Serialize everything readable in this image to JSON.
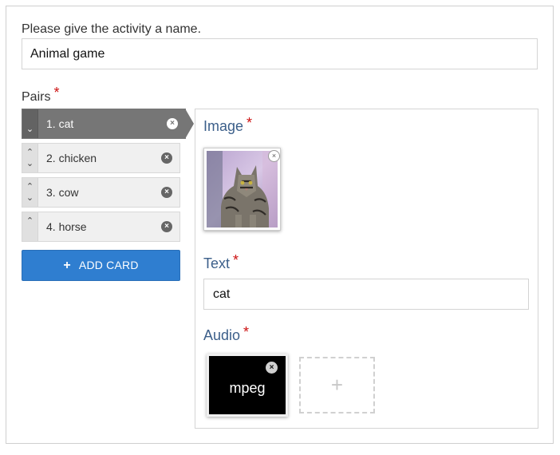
{
  "header": {
    "title_label": "Please give the activity a name.",
    "title_value": "Animal game"
  },
  "pairs": {
    "label": "Pairs",
    "required_mark": "*",
    "items": [
      {
        "label": "1. cat",
        "active": true
      },
      {
        "label": "2. chicken",
        "active": false
      },
      {
        "label": "3. cow",
        "active": false
      },
      {
        "label": "4. horse",
        "active": false
      }
    ],
    "remove_glyph": "×",
    "up_glyph": "⌃",
    "down_glyph": "⌄",
    "add_button_label": "ADD CARD",
    "add_button_icon": "+"
  },
  "editor": {
    "image_label": "Image",
    "image_required": "*",
    "image_icon": "cat-photo",
    "text_label": "Text",
    "text_required": "*",
    "text_value": "cat",
    "audio_label": "Audio",
    "audio_required": "*",
    "audio_file_type": "mpeg",
    "audio_add_glyph": "+"
  },
  "colors": {
    "accent": "#2f7ed0",
    "active_pair": "#767676",
    "label_blue": "#3c5f8a",
    "required": "#cc1111"
  }
}
